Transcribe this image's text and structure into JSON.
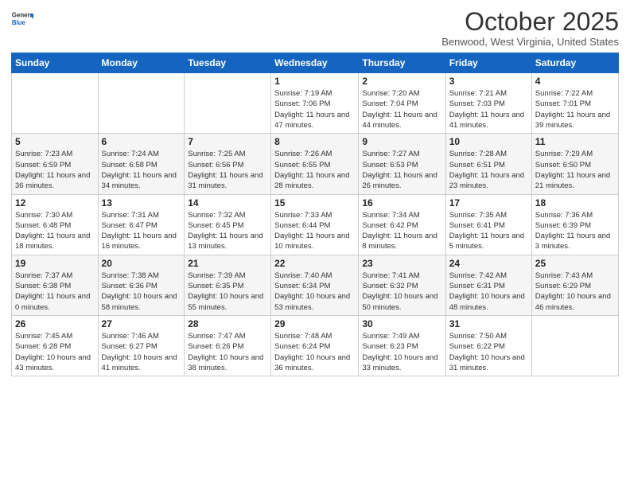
{
  "logo": {
    "general": "General",
    "blue": "Blue"
  },
  "header": {
    "month": "October 2025",
    "location": "Benwood, West Virginia, United States"
  },
  "days_of_week": [
    "Sunday",
    "Monday",
    "Tuesday",
    "Wednesday",
    "Thursday",
    "Friday",
    "Saturday"
  ],
  "weeks": [
    [
      {
        "day": "",
        "info": ""
      },
      {
        "day": "",
        "info": ""
      },
      {
        "day": "",
        "info": ""
      },
      {
        "day": "1",
        "info": "Sunrise: 7:19 AM\nSunset: 7:06 PM\nDaylight: 11 hours and 47 minutes."
      },
      {
        "day": "2",
        "info": "Sunrise: 7:20 AM\nSunset: 7:04 PM\nDaylight: 11 hours and 44 minutes."
      },
      {
        "day": "3",
        "info": "Sunrise: 7:21 AM\nSunset: 7:03 PM\nDaylight: 11 hours and 41 minutes."
      },
      {
        "day": "4",
        "info": "Sunrise: 7:22 AM\nSunset: 7:01 PM\nDaylight: 11 hours and 39 minutes."
      }
    ],
    [
      {
        "day": "5",
        "info": "Sunrise: 7:23 AM\nSunset: 6:59 PM\nDaylight: 11 hours and 36 minutes."
      },
      {
        "day": "6",
        "info": "Sunrise: 7:24 AM\nSunset: 6:58 PM\nDaylight: 11 hours and 34 minutes."
      },
      {
        "day": "7",
        "info": "Sunrise: 7:25 AM\nSunset: 6:56 PM\nDaylight: 11 hours and 31 minutes."
      },
      {
        "day": "8",
        "info": "Sunrise: 7:26 AM\nSunset: 6:55 PM\nDaylight: 11 hours and 28 minutes."
      },
      {
        "day": "9",
        "info": "Sunrise: 7:27 AM\nSunset: 6:53 PM\nDaylight: 11 hours and 26 minutes."
      },
      {
        "day": "10",
        "info": "Sunrise: 7:28 AM\nSunset: 6:51 PM\nDaylight: 11 hours and 23 minutes."
      },
      {
        "day": "11",
        "info": "Sunrise: 7:29 AM\nSunset: 6:50 PM\nDaylight: 11 hours and 21 minutes."
      }
    ],
    [
      {
        "day": "12",
        "info": "Sunrise: 7:30 AM\nSunset: 6:48 PM\nDaylight: 11 hours and 18 minutes."
      },
      {
        "day": "13",
        "info": "Sunrise: 7:31 AM\nSunset: 6:47 PM\nDaylight: 11 hours and 16 minutes."
      },
      {
        "day": "14",
        "info": "Sunrise: 7:32 AM\nSunset: 6:45 PM\nDaylight: 11 hours and 13 minutes."
      },
      {
        "day": "15",
        "info": "Sunrise: 7:33 AM\nSunset: 6:44 PM\nDaylight: 11 hours and 10 minutes."
      },
      {
        "day": "16",
        "info": "Sunrise: 7:34 AM\nSunset: 6:42 PM\nDaylight: 11 hours and 8 minutes."
      },
      {
        "day": "17",
        "info": "Sunrise: 7:35 AM\nSunset: 6:41 PM\nDaylight: 11 hours and 5 minutes."
      },
      {
        "day": "18",
        "info": "Sunrise: 7:36 AM\nSunset: 6:39 PM\nDaylight: 11 hours and 3 minutes."
      }
    ],
    [
      {
        "day": "19",
        "info": "Sunrise: 7:37 AM\nSunset: 6:38 PM\nDaylight: 11 hours and 0 minutes."
      },
      {
        "day": "20",
        "info": "Sunrise: 7:38 AM\nSunset: 6:36 PM\nDaylight: 10 hours and 58 minutes."
      },
      {
        "day": "21",
        "info": "Sunrise: 7:39 AM\nSunset: 6:35 PM\nDaylight: 10 hours and 55 minutes."
      },
      {
        "day": "22",
        "info": "Sunrise: 7:40 AM\nSunset: 6:34 PM\nDaylight: 10 hours and 53 minutes."
      },
      {
        "day": "23",
        "info": "Sunrise: 7:41 AM\nSunset: 6:32 PM\nDaylight: 10 hours and 50 minutes."
      },
      {
        "day": "24",
        "info": "Sunrise: 7:42 AM\nSunset: 6:31 PM\nDaylight: 10 hours and 48 minutes."
      },
      {
        "day": "25",
        "info": "Sunrise: 7:43 AM\nSunset: 6:29 PM\nDaylight: 10 hours and 46 minutes."
      }
    ],
    [
      {
        "day": "26",
        "info": "Sunrise: 7:45 AM\nSunset: 6:28 PM\nDaylight: 10 hours and 43 minutes."
      },
      {
        "day": "27",
        "info": "Sunrise: 7:46 AM\nSunset: 6:27 PM\nDaylight: 10 hours and 41 minutes."
      },
      {
        "day": "28",
        "info": "Sunrise: 7:47 AM\nSunset: 6:26 PM\nDaylight: 10 hours and 38 minutes."
      },
      {
        "day": "29",
        "info": "Sunrise: 7:48 AM\nSunset: 6:24 PM\nDaylight: 10 hours and 36 minutes."
      },
      {
        "day": "30",
        "info": "Sunrise: 7:49 AM\nSunset: 6:23 PM\nDaylight: 10 hours and 33 minutes."
      },
      {
        "day": "31",
        "info": "Sunrise: 7:50 AM\nSunset: 6:22 PM\nDaylight: 10 hours and 31 minutes."
      },
      {
        "day": "",
        "info": ""
      }
    ]
  ]
}
